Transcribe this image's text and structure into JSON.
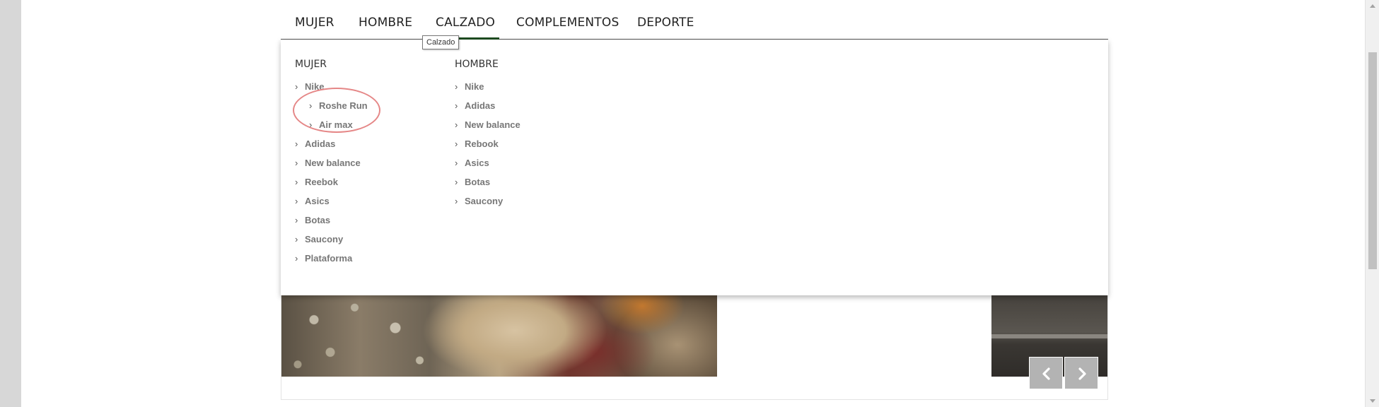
{
  "nav": {
    "items": [
      "MUJER",
      "HOMBRE",
      "CALZADO",
      "COMPLEMENTOS",
      "DEPORTE"
    ],
    "active": "CALZADO"
  },
  "tooltip": {
    "text": "Calzado"
  },
  "dropdown": {
    "columns": [
      {
        "title": "MUJER",
        "items": [
          {
            "label": "Nike",
            "sub": false
          },
          {
            "label": "Roshe Run",
            "sub": true
          },
          {
            "label": "Air max",
            "sub": true
          },
          {
            "label": "Adidas",
            "sub": false
          },
          {
            "label": "New balance",
            "sub": false
          },
          {
            "label": "Reebok",
            "sub": false
          },
          {
            "label": "Asics",
            "sub": false
          },
          {
            "label": "Botas",
            "sub": false
          },
          {
            "label": "Saucony",
            "sub": false
          },
          {
            "label": "Plataforma",
            "sub": false
          }
        ]
      },
      {
        "title": "HOMBRE",
        "items": [
          {
            "label": "Nike",
            "sub": false
          },
          {
            "label": "Adidas",
            "sub": false
          },
          {
            "label": "New balance",
            "sub": false
          },
          {
            "label": "Rebook",
            "sub": false
          },
          {
            "label": "Asics",
            "sub": false
          },
          {
            "label": "Botas",
            "sub": false
          },
          {
            "label": "Saucony",
            "sub": false
          }
        ]
      }
    ]
  },
  "colors": {
    "active_underline": "#1e4d20",
    "highlight_ring": "#e58787",
    "slider_button": "#b3b3b3"
  },
  "icons": {
    "slider_prev": "chevron-left-icon",
    "slider_next": "chevron-right-icon",
    "menu_bullet": "chevron-right-icon"
  }
}
